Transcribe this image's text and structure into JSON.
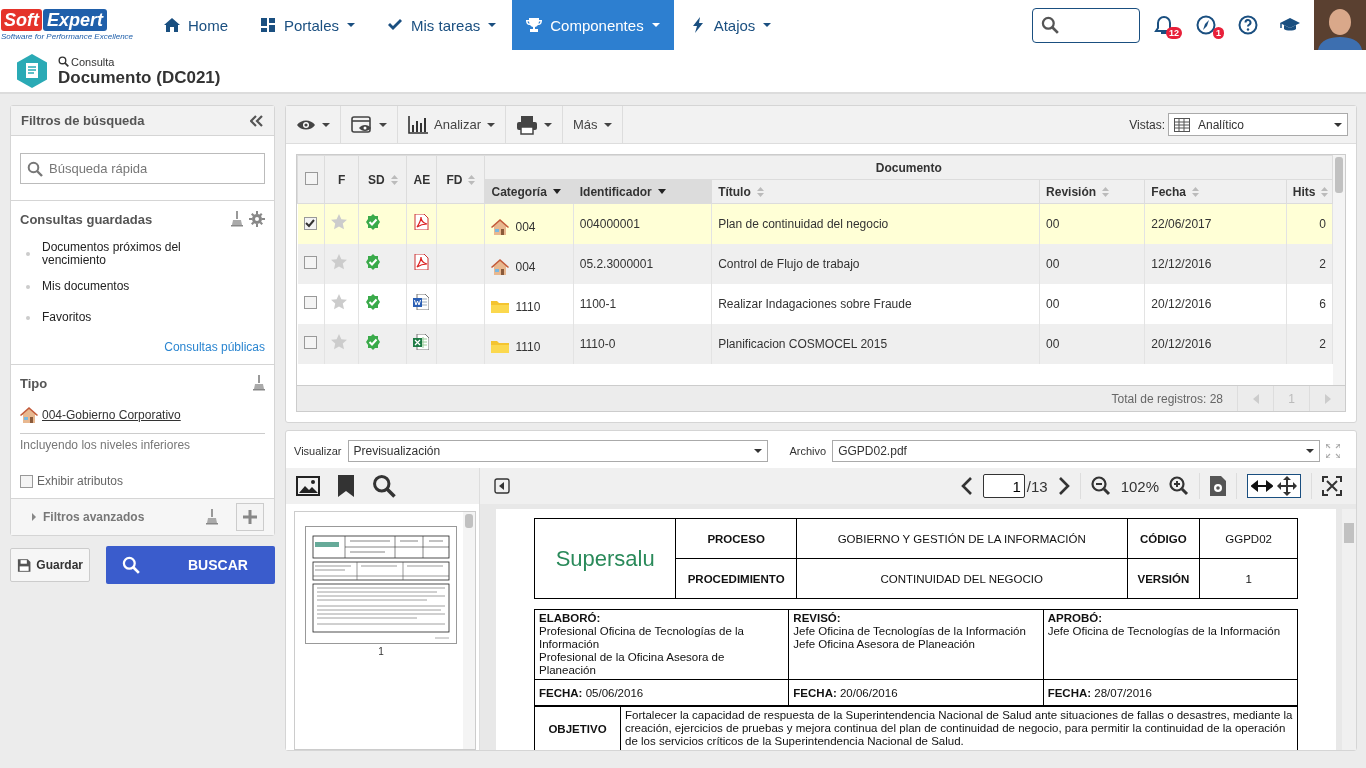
{
  "header": {
    "logo": {
      "left": "Soft",
      "right": "Expert",
      "tagline": "Software for Performance Excellence"
    },
    "nav": [
      {
        "kind": "home",
        "label": "Home",
        "dropdown": false,
        "selected": false
      },
      {
        "kind": "portals",
        "label": "Portales",
        "dropdown": true,
        "selected": false
      },
      {
        "kind": "tasks",
        "label": "Mis tareas",
        "dropdown": true,
        "selected": false
      },
      {
        "kind": "components",
        "label": "Componentes",
        "dropdown": true,
        "selected": true
      },
      {
        "kind": "shortcuts",
        "label": "Atajos",
        "dropdown": true,
        "selected": false
      }
    ],
    "tools": [
      {
        "kind": "bell",
        "badge": "12"
      },
      {
        "kind": "compass",
        "badge": "1"
      },
      {
        "kind": "help"
      },
      {
        "kind": "learning"
      }
    ]
  },
  "page_title": {
    "mode": "Consulta",
    "title": "Documento (DC021)"
  },
  "filters": {
    "title": "Filtros de búsqueda",
    "quick_search": {
      "placeholder": "Búsqueda rápida"
    },
    "saved": {
      "title": "Consultas guardadas",
      "items": [
        "Documentos próximos del vencimiento",
        "Mis documentos",
        "Favoritos"
      ],
      "link": "Consultas públicas"
    },
    "type": {
      "title": "Tipo",
      "value": "004-Gobierno Corporativo",
      "note": "Incluyendo los niveles inferiores",
      "show_attributes": {
        "label": "Exhibir atributos",
        "checked": false
      }
    },
    "advanced": {
      "label": "Filtros avanzados",
      "expanded": false
    }
  },
  "actions": {
    "save": "Guardar",
    "search": "BUSCAR"
  },
  "toolbar": {
    "menus": [
      {
        "kind": "view"
      },
      {
        "kind": "preview"
      },
      {
        "kind": "analyze",
        "label": "Analizar"
      },
      {
        "kind": "print"
      },
      {
        "kind": "more",
        "label": "Más"
      }
    ],
    "views": {
      "label": "Vistas:",
      "value": "Analítico"
    }
  },
  "table": {
    "group_header": "Documento",
    "select_all": {
      "checked": false
    },
    "columns": [
      {
        "label": "F",
        "sortable": false,
        "sorted": false
      },
      {
        "label": "SD",
        "sortable": true,
        "sorted": false
      },
      {
        "label": "AE",
        "sortable": false,
        "sorted": false
      },
      {
        "label": "FD",
        "sortable": true,
        "sorted": false
      },
      {
        "label": "Categoría",
        "sortable": true,
        "sorted": true
      },
      {
        "label": "Identificador",
        "sortable": true,
        "sorted": true
      },
      {
        "label": "Título",
        "sortable": true,
        "sorted": false
      },
      {
        "label": "Revisión",
        "sortable": true,
        "sorted": false
      },
      {
        "label": "Fecha",
        "sortable": true,
        "sorted": false
      },
      {
        "label": "Hits",
        "sortable": true,
        "sorted": false
      }
    ],
    "rows": [
      {
        "checked": true,
        "selected": true,
        "favorite": false,
        "file": {
          "kind": "pdf"
        },
        "category": {
          "kind": "house",
          "label": "004"
        },
        "identifier": "004000001",
        "title": "Plan de continuidad del negocio",
        "revision": "00",
        "date": "22/06/2017",
        "hits": "0"
      },
      {
        "checked": false,
        "selected": false,
        "favorite": false,
        "file": {
          "kind": "pdf"
        },
        "category": {
          "kind": "house",
          "label": "004"
        },
        "identifier": "05.2.3000001",
        "title": "Control de Flujo de trabajo",
        "revision": "00",
        "date": "12/12/2016",
        "hits": "2"
      },
      {
        "checked": false,
        "selected": false,
        "favorite": false,
        "file": {
          "kind": "word"
        },
        "category": {
          "kind": "folder",
          "label": "1110"
        },
        "identifier": "1100-1",
        "title": "Realizar Indagaciones sobre Fraude",
        "revision": "00",
        "date": "20/12/2016",
        "hits": "6"
      },
      {
        "checked": false,
        "selected": false,
        "favorite": false,
        "file": {
          "kind": "excel"
        },
        "category": {
          "kind": "folder",
          "label": "1110"
        },
        "identifier": "1110-0",
        "title": "Planificacion COSMOCEL 2015",
        "revision": "00",
        "date": "20/12/2016",
        "hits": "2"
      }
    ],
    "total": "Total de registros: 28",
    "page": "1"
  },
  "viewer": {
    "view_label": "Visualizar",
    "view_value": "Previsualización",
    "file_label": "Archivo",
    "file_value": "GGPD02.pdf",
    "page_input": "1",
    "page_total": "/13",
    "zoom": "102%",
    "fit_width": {
      "selected": true
    },
    "thumbnail_page": "1",
    "document": {
      "logo": "Supersalu",
      "header": [
        [
          "PROCESO",
          "GOBIERNO Y GESTIÓN DE LA INFORMACIÓN",
          "CÓDIGO",
          "GGPD02"
        ],
        [
          "PROCEDIMIENTO",
          "CONTINUIDAD DEL NEGOCIO",
          "VERSIÓN",
          "1"
        ]
      ],
      "approvals": [
        {
          "heading": "ELABORÓ:",
          "lines": [
            "Profesional Oficina de Tecnologías de la Información",
            "Profesional de la Oficina Asesora de Planeación"
          ],
          "date": "**FECHA:** 05/06/2016"
        },
        {
          "heading": "REVISÓ:",
          "lines": [
            "Jefe Oficina de Tecnologías de la Información",
            "Jefe Oficina Asesora de Planeación"
          ],
          "date": "**FECHA:** 20/06/2016"
        },
        {
          "heading": "APROBÓ:",
          "lines": [
            "Jefe Oficina de Tecnologías de la Información"
          ],
          "date": "**FECHA:** 28/07/2016"
        }
      ],
      "objective": {
        "label": "OBJETIVO",
        "text": "Fortalecer la capacidad de respuesta de la Superintendencia Nacional de Salud ante situaciones de fallas o desastres, mediante la creación, ejercicios de pruebas y mejora continua del plan de continuidad de negocio, para permitir la continuidad de la operación de los servicios críticos de la Superintendencia Nacional de Salud."
      }
    }
  }
}
